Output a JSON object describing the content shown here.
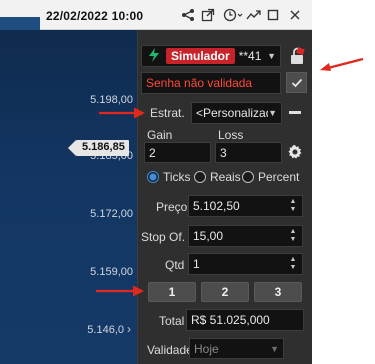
{
  "header": {
    "datetime": "22/02/2022 10:00",
    "icons": [
      "share-icon",
      "popout-icon",
      "clock-icon",
      "chart-line-icon",
      "maximize-icon",
      "close-icon"
    ]
  },
  "chart": {
    "prices": [
      "5.198,00",
      "5.185,00",
      "5.172,00",
      "5.159,00",
      "5.146,0"
    ],
    "current_price": "5.186,85"
  },
  "panel": {
    "mode": "Simulador",
    "account": "**41",
    "password_placeholder": "Senha não validada",
    "strategy_label": "Estrat.",
    "strategy_value": "<Personalizada",
    "gain_label": "Gain",
    "gain_value": "2",
    "loss_label": "Loss",
    "loss_value": "3",
    "units": [
      {
        "label": "Ticks",
        "selected": true
      },
      {
        "label": "Reais",
        "selected": false
      },
      {
        "label": "Percent",
        "selected": false
      }
    ],
    "price_label": "Preço",
    "price_value": "5.102,50",
    "stop_label": "Stop Of.",
    "stop_value": "15,00",
    "qty_label": "Qtd",
    "qty_value": "1",
    "quick_buttons": [
      "1",
      "2",
      "3"
    ],
    "total_label": "Total",
    "total_value": "R$ 51.025,000",
    "validity_label": "Validade",
    "validity_value": "Hoje"
  },
  "colors": {
    "accent_red": "#e0281e",
    "simulator_badge": "#c8232b",
    "radio_blue": "#3f8fe0",
    "panel_bg": "#2f2f2f",
    "chart_bg": "#133663"
  }
}
